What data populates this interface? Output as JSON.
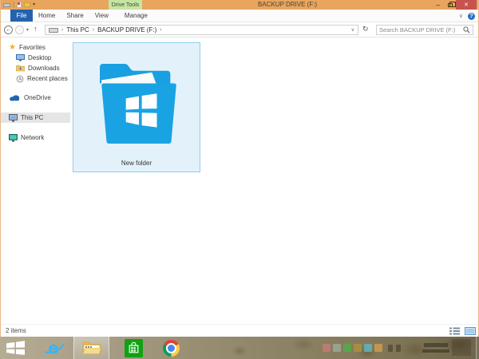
{
  "window": {
    "title": "BACKUP DRIVE (F:)",
    "contextual_group": "Drive Tools"
  },
  "ribbon": {
    "tabs": [
      {
        "label": "File"
      },
      {
        "label": "Home"
      },
      {
        "label": "Share"
      },
      {
        "label": "View"
      },
      {
        "label": "Manage"
      }
    ]
  },
  "address_bar": {
    "segments": [
      "This PC",
      "BACKUP DRIVE (F:)"
    ],
    "search_placeholder": "Search BACKUP DRIVE (F:)"
  },
  "sidebar": {
    "items": [
      {
        "label": "Favorites"
      },
      {
        "label": "Desktop"
      },
      {
        "label": "Downloads"
      },
      {
        "label": "Recent places"
      },
      {
        "label": "OneDrive"
      },
      {
        "label": "This PC",
        "selected": true
      },
      {
        "label": "Network"
      }
    ]
  },
  "content": {
    "items": [
      {
        "name": "New folder",
        "type": "folder",
        "selected": true
      }
    ]
  },
  "status_bar": {
    "item_count": "2 items"
  },
  "taskbar": {
    "buttons": [
      {
        "name": "start"
      },
      {
        "name": "internet-explorer"
      },
      {
        "name": "file-explorer",
        "active": true
      },
      {
        "name": "windows-store"
      },
      {
        "name": "google-chrome"
      }
    ]
  },
  "glyphs": {
    "minimize": "–",
    "close": "✕",
    "chevron_down": "∨",
    "caret_down": "▾",
    "back": "←",
    "forward": "→",
    "up": "↑",
    "refresh": "↻",
    "crumb": "›",
    "help": "?",
    "star": "★",
    "qat_sep": "|"
  },
  "colors": {
    "titlebar": "#e7a55e",
    "close_button": "#c85250",
    "file_tab": "#2363ae",
    "contextual_tab_bg": "#c6e5a3",
    "folder_icon_blue": "#1aa3e3",
    "selection_bg": "#e3f1fb",
    "selection_border": "#8ecdf0",
    "store_green": "#12a112"
  }
}
